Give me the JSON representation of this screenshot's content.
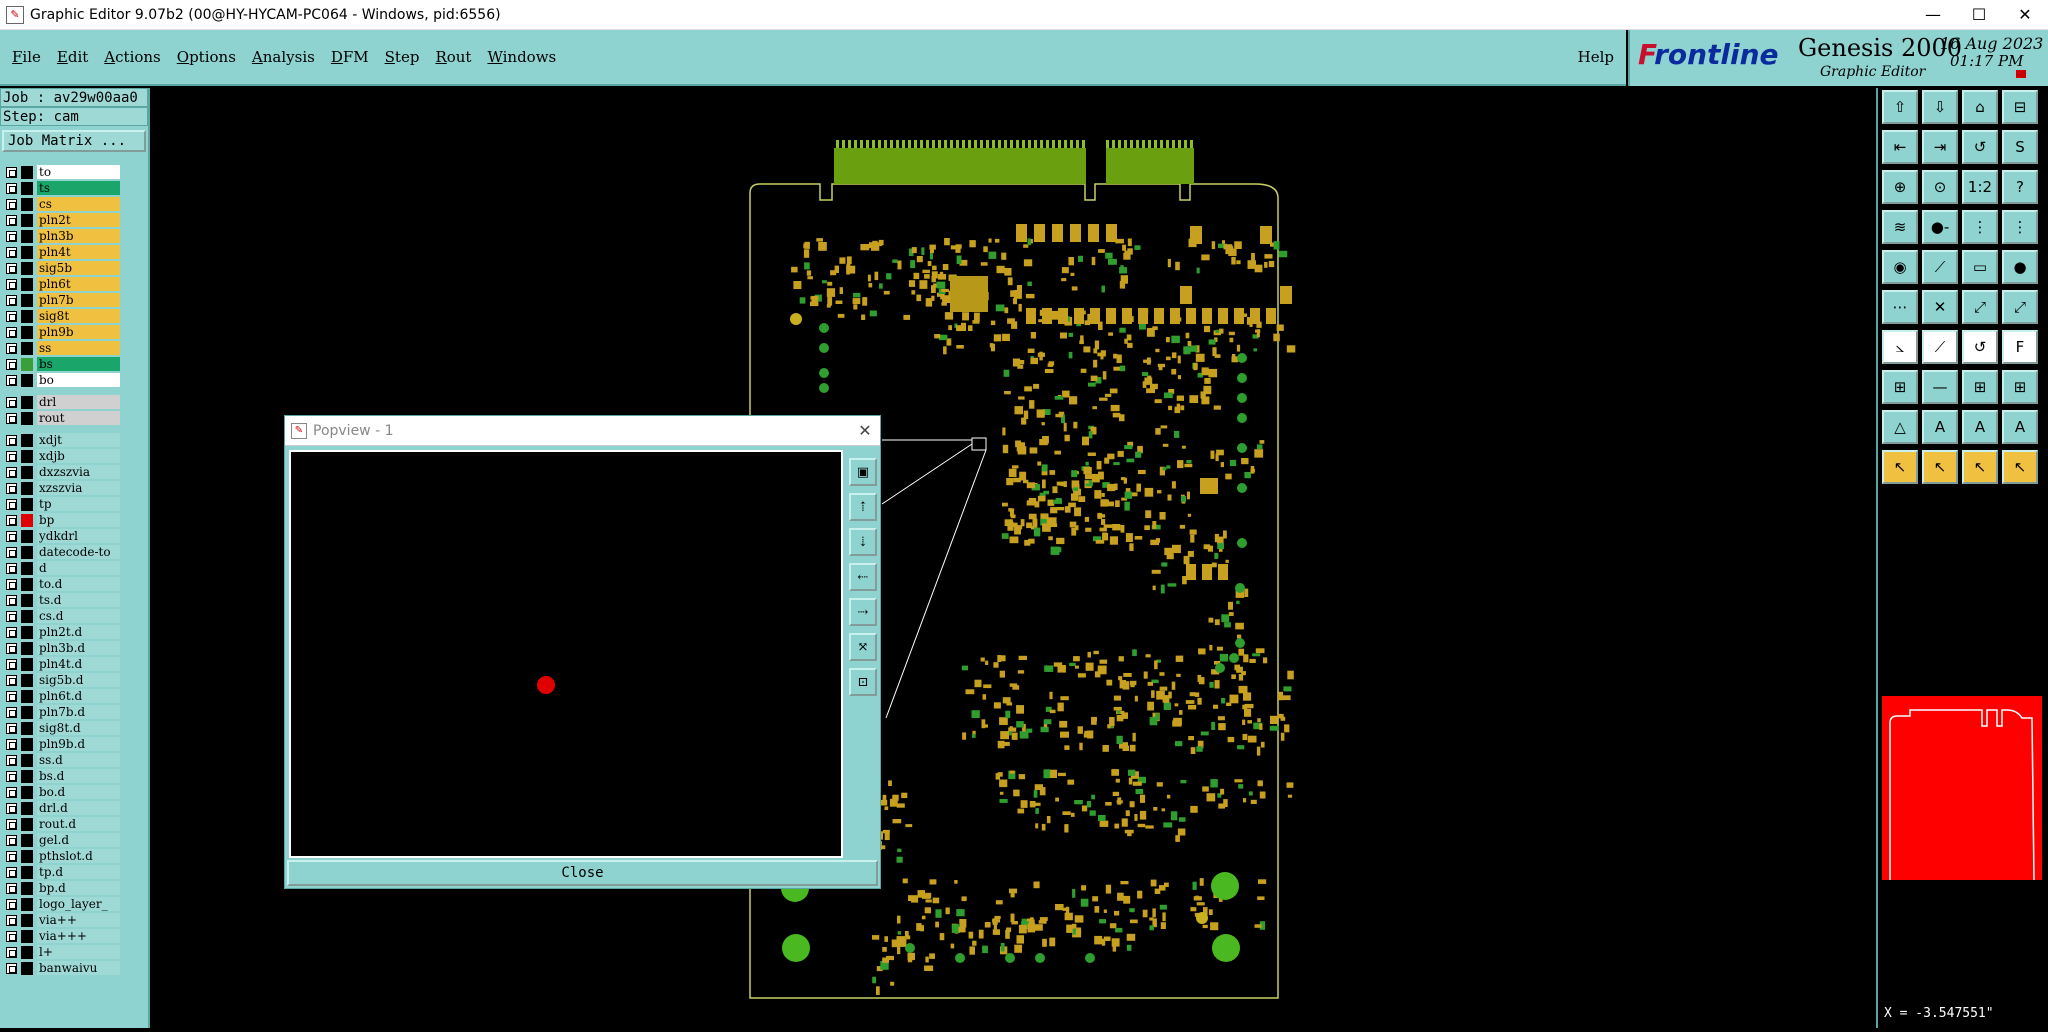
{
  "window": {
    "title": "Graphic Editor 9.07b2 (00@HY-HYCAM-PC064 - Windows, pid:6556)",
    "minimize": "—",
    "maximize": "☐",
    "close": "✕"
  },
  "menu": {
    "items": [
      {
        "u": "F",
        "rest": "ile"
      },
      {
        "u": "E",
        "rest": "dit"
      },
      {
        "u": "A",
        "rest": "ctions"
      },
      {
        "u": "O",
        "rest": "ptions"
      },
      {
        "u": "A",
        "rest": "nalysis"
      },
      {
        "u": "D",
        "rest": "FM"
      },
      {
        "u": "S",
        "rest": "tep"
      },
      {
        "u": "R",
        "rest": "out"
      },
      {
        "u": "W",
        "rest": "indows"
      }
    ],
    "help": "Help"
  },
  "brand": {
    "logo_f": "F",
    "logo_rest": "rontline",
    "product": "Genesis 2000",
    "subtitle": "Graphic Editor",
    "date": "16 Aug 2023",
    "time": "01:17 PM"
  },
  "job": {
    "job_label": "Job : av29w00aa0",
    "step_label": "Step: cam",
    "matrix_button": "Job Matrix ..."
  },
  "layers_top": [
    {
      "name": "to",
      "bg": "#ffffff",
      "swatch": "#000000"
    },
    {
      "name": "ts",
      "bg": "#1aa56a",
      "swatch": "#000000"
    },
    {
      "name": "cs",
      "bg": "#f0c040",
      "swatch": "#000000"
    },
    {
      "name": "pln2t",
      "bg": "#f0c040",
      "swatch": "#000000"
    },
    {
      "name": "pln3b",
      "bg": "#f0c040",
      "swatch": "#000000"
    },
    {
      "name": "pln4t",
      "bg": "#f0c040",
      "swatch": "#000000"
    },
    {
      "name": "sig5b",
      "bg": "#f0c040",
      "swatch": "#000000"
    },
    {
      "name": "pln6t",
      "bg": "#f0c040",
      "swatch": "#000000"
    },
    {
      "name": "pln7b",
      "bg": "#f0c040",
      "swatch": "#000000"
    },
    {
      "name": "sig8t",
      "bg": "#f0c040",
      "swatch": "#000000"
    },
    {
      "name": "pln9b",
      "bg": "#f0c040",
      "swatch": "#000000"
    },
    {
      "name": "ss",
      "bg": "#f0c040",
      "swatch": "#000000"
    },
    {
      "name": "bs",
      "bg": "#1aa56a",
      "swatch": "#3a9e3a"
    },
    {
      "name": "bo",
      "bg": "#ffffff",
      "swatch": "#000000"
    }
  ],
  "layers_drill": [
    {
      "name": "drl",
      "bg": "#d0d0d0",
      "swatch": "#000000"
    },
    {
      "name": "rout",
      "bg": "#d0d0d0",
      "swatch": "#000000"
    }
  ],
  "layers_misc": [
    {
      "name": "xdjt",
      "bg": "#9fd9d5",
      "swatch": "#000000"
    },
    {
      "name": "xdjb",
      "bg": "#9fd9d5",
      "swatch": "#000000"
    },
    {
      "name": "dxzszvia",
      "bg": "#9fd9d5",
      "swatch": "#000000"
    },
    {
      "name": "xzszvia",
      "bg": "#9fd9d5",
      "swatch": "#000000"
    },
    {
      "name": "tp",
      "bg": "#9fd9d5",
      "swatch": "#000000"
    },
    {
      "name": "bp",
      "bg": "#9fd9d5",
      "swatch": "#e00000"
    },
    {
      "name": "ydkdrl",
      "bg": "#9fd9d5",
      "swatch": "#000000"
    },
    {
      "name": "datecode-to",
      "bg": "#9fd9d5",
      "swatch": "#000000"
    },
    {
      "name": "d",
      "bg": "#9fd9d5",
      "swatch": "#000000"
    },
    {
      "name": "to.d",
      "bg": "#9fd9d5",
      "swatch": "#000000"
    },
    {
      "name": "ts.d",
      "bg": "#9fd9d5",
      "swatch": "#000000"
    },
    {
      "name": "cs.d",
      "bg": "#9fd9d5",
      "swatch": "#000000"
    },
    {
      "name": "pln2t.d",
      "bg": "#9fd9d5",
      "swatch": "#000000"
    },
    {
      "name": "pln3b.d",
      "bg": "#9fd9d5",
      "swatch": "#000000"
    },
    {
      "name": "pln4t.d",
      "bg": "#9fd9d5",
      "swatch": "#000000"
    },
    {
      "name": "sig5b.d",
      "bg": "#9fd9d5",
      "swatch": "#000000"
    },
    {
      "name": "pln6t.d",
      "bg": "#9fd9d5",
      "swatch": "#000000"
    },
    {
      "name": "pln7b.d",
      "bg": "#9fd9d5",
      "swatch": "#000000"
    },
    {
      "name": "sig8t.d",
      "bg": "#9fd9d5",
      "swatch": "#000000"
    },
    {
      "name": "pln9b.d",
      "bg": "#9fd9d5",
      "swatch": "#000000"
    },
    {
      "name": "ss.d",
      "bg": "#9fd9d5",
      "swatch": "#000000"
    },
    {
      "name": "bs.d",
      "bg": "#9fd9d5",
      "swatch": "#000000"
    },
    {
      "name": "bo.d",
      "bg": "#9fd9d5",
      "swatch": "#000000"
    },
    {
      "name": "drl.d",
      "bg": "#9fd9d5",
      "swatch": "#000000"
    },
    {
      "name": "rout.d",
      "bg": "#9fd9d5",
      "swatch": "#000000"
    },
    {
      "name": "gel.d",
      "bg": "#9fd9d5",
      "swatch": "#000000"
    },
    {
      "name": "pthslot.d",
      "bg": "#9fd9d5",
      "swatch": "#000000"
    },
    {
      "name": "tp.d",
      "bg": "#9fd9d5",
      "swatch": "#000000"
    },
    {
      "name": "bp.d",
      "bg": "#9fd9d5",
      "swatch": "#000000"
    },
    {
      "name": "logo_layer_",
      "bg": "#9fd9d5",
      "swatch": "#000000"
    },
    {
      "name": "via++",
      "bg": "#9fd9d5",
      "swatch": "#000000"
    },
    {
      "name": "via+++",
      "bg": "#9fd9d5",
      "swatch": "#000000"
    },
    {
      "name": "l+",
      "bg": "#9fd9d5",
      "swatch": "#000000"
    },
    {
      "name": "banwaivu",
      "bg": "#9fd9d5",
      "swatch": "#000000"
    }
  ],
  "popview": {
    "title": "Popview - 1",
    "close_icon": "✕",
    "close_button": "Close",
    "tools": [
      "zoom-in-icon",
      "open-up-icon",
      "open-down-icon",
      "open-left-icon",
      "open-right-icon",
      "zoom-fit-icon",
      "zoom-reset-icon"
    ],
    "tool_glyphs": [
      "▣",
      "⇡",
      "⇣",
      "⇠",
      "⇢",
      "⤧",
      "⊡"
    ]
  },
  "toolbox": {
    "glyphs": [
      "⇧",
      "⇩",
      "⌂",
      "⊟",
      "⇤",
      "⇥",
      "↺",
      "S",
      "⊕",
      "⊙",
      "1:2",
      "?",
      "≋",
      "●-",
      "⋮",
      "⋮",
      "◉",
      "⟋",
      "▭",
      "●",
      "⋯",
      "✕",
      "⤢",
      "⤢",
      "⦣",
      "⟋",
      "↺",
      "F",
      "⊞",
      "—",
      "⊞",
      "⊞",
      "△",
      "A",
      "A",
      "A",
      "↖",
      "↖",
      "↖",
      "↖"
    ]
  },
  "coords": {
    "x": "X = -3.547551\""
  },
  "colors": {
    "panel": "#8ed3cf",
    "green_layer": "#1aa56a",
    "yellow_layer": "#f0c040",
    "board_red": "#ff0000",
    "pad_yellow": "#c8a020",
    "pad_green": "#2f9e2f"
  }
}
